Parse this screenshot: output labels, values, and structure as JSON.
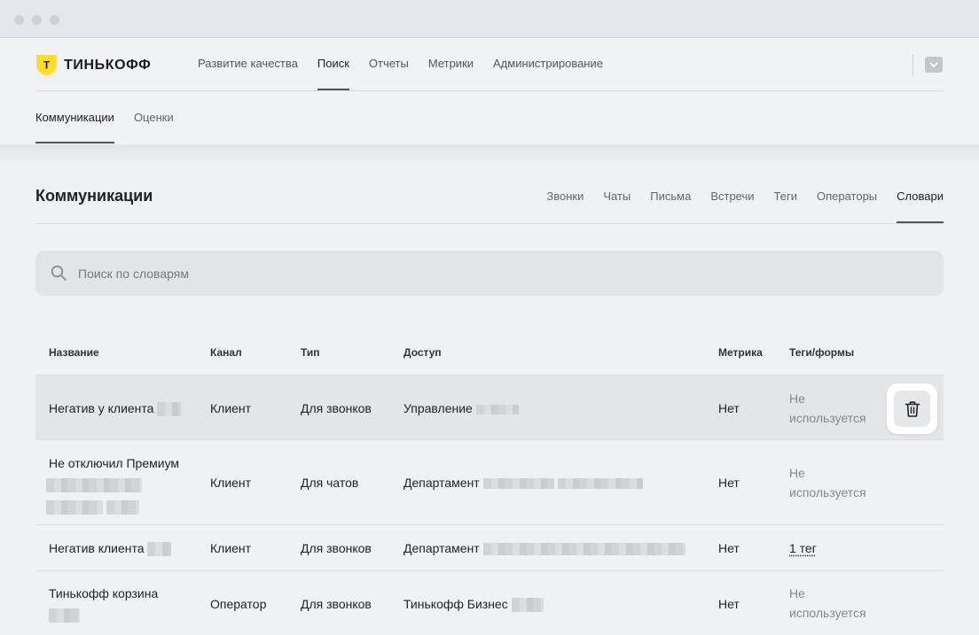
{
  "app": {
    "logo_text": "ТИНЬКОФФ",
    "logo_letter": "Т",
    "brand_color": "#ffdd2d"
  },
  "topnav": {
    "items": [
      "Развитие качества",
      "Поиск",
      "Отчеты",
      "Метрики",
      "Администрирование"
    ],
    "active": "Поиск"
  },
  "subnav": {
    "items": [
      "Коммуникации",
      "Оценки"
    ],
    "active": "Коммуникации"
  },
  "page": {
    "title": "Коммуникации"
  },
  "tabs": {
    "items": [
      "Звонки",
      "Чаты",
      "Письма",
      "Встречи",
      "Теги",
      "Операторы",
      "Словари"
    ],
    "active": "Словари"
  },
  "search": {
    "placeholder": "Поиск по словарям",
    "value": ""
  },
  "table": {
    "headers": {
      "name": "Название",
      "channel": "Канал",
      "type": "Тип",
      "access": "Доступ",
      "metric": "Метрика",
      "tags": "Теги/формы"
    },
    "rows": [
      {
        "name": "Негатив у клиента",
        "channel": "Клиент",
        "type": "Для звонков",
        "access": "Управление",
        "metric": "Нет",
        "tags_line1": "Не",
        "tags_line2": "используется"
      },
      {
        "name": "Не отключил Премиум",
        "channel": "Клиент",
        "type": "Для чатов",
        "access": "Департамент",
        "metric": "Нет",
        "tags_line1": "Не",
        "tags_line2": "используется"
      },
      {
        "name": "Негатив клиента",
        "channel": "Клиент",
        "type": "Для звонков",
        "access": "Департамент",
        "metric": "Нет",
        "tags_link": "1 тег"
      },
      {
        "name": "Тинькофф корзина",
        "channel": "Оператор",
        "type": "Для звонков",
        "access": "Тинькофф Бизнес",
        "metric": "Нет",
        "tags_line1": "Не",
        "tags_line2": "используется"
      }
    ]
  },
  "icons": {
    "search": "search-icon",
    "delete": "trash-icon",
    "menu": "chevron-down-icon"
  }
}
